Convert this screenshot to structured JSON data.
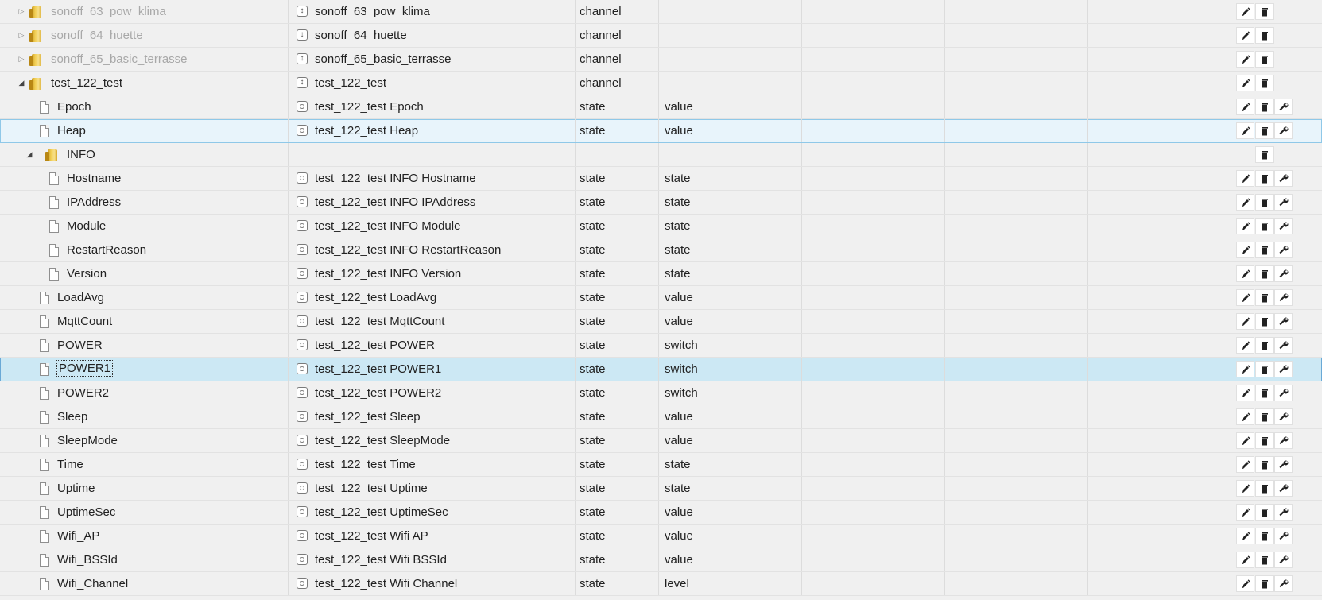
{
  "rows": [
    {
      "name": "sonoff_63_pow_klima",
      "kind": "folder",
      "level": 0,
      "toggle": "closed",
      "dim": true,
      "obj_icon": "channel-icon",
      "label": "sonoff_63_pow_klima",
      "type": "channel",
      "role": "",
      "buttons": [
        "edit",
        "delete"
      ]
    },
    {
      "name": "sonoff_64_huette",
      "kind": "folder",
      "level": 0,
      "toggle": "closed",
      "dim": true,
      "obj_icon": "channel-icon",
      "label": "sonoff_64_huette",
      "type": "channel",
      "role": "",
      "buttons": [
        "edit",
        "delete"
      ]
    },
    {
      "name": "sonoff_65_basic_terrasse",
      "kind": "folder",
      "level": 0,
      "toggle": "closed",
      "dim": true,
      "obj_icon": "channel-icon",
      "label": "sonoff_65_basic_terrasse",
      "type": "channel",
      "role": "",
      "buttons": [
        "edit",
        "delete"
      ]
    },
    {
      "name": "test_122_test",
      "kind": "folder",
      "level": 0,
      "toggle": "open",
      "dim": false,
      "obj_icon": "channel-icon",
      "label": "test_122_test",
      "type": "channel",
      "role": "",
      "buttons": [
        "edit",
        "delete"
      ]
    },
    {
      "name": "Epoch",
      "kind": "file",
      "level": 1,
      "obj_icon": "state-icon",
      "label": "test_122_test Epoch",
      "type": "state",
      "role": "value",
      "buttons": [
        "edit",
        "delete",
        "settings"
      ]
    },
    {
      "name": "Heap",
      "kind": "file",
      "level": 1,
      "obj_icon": "state-icon",
      "label": "test_122_test Heap",
      "type": "state",
      "role": "value",
      "buttons": [
        "edit",
        "delete",
        "settings"
      ],
      "state": "hover"
    },
    {
      "name": "INFO",
      "kind": "folder",
      "level": 1,
      "toggle": "open",
      "dim": false,
      "obj_icon": "",
      "label": "",
      "type": "",
      "role": "",
      "buttons": [
        "none",
        "delete"
      ]
    },
    {
      "name": "Hostname",
      "kind": "file",
      "level": 2,
      "obj_icon": "state-icon",
      "label": "test_122_test INFO Hostname",
      "type": "state",
      "role": "state",
      "buttons": [
        "edit",
        "delete",
        "settings"
      ]
    },
    {
      "name": "IPAddress",
      "kind": "file",
      "level": 2,
      "obj_icon": "state-icon",
      "label": "test_122_test INFO IPAddress",
      "type": "state",
      "role": "state",
      "buttons": [
        "edit",
        "delete",
        "settings"
      ]
    },
    {
      "name": "Module",
      "kind": "file",
      "level": 2,
      "obj_icon": "state-icon",
      "label": "test_122_test INFO Module",
      "type": "state",
      "role": "state",
      "buttons": [
        "edit",
        "delete",
        "settings"
      ]
    },
    {
      "name": "RestartReason",
      "kind": "file",
      "level": 2,
      "obj_icon": "state-icon",
      "label": "test_122_test INFO RestartReason",
      "type": "state",
      "role": "state",
      "buttons": [
        "edit",
        "delete",
        "settings"
      ]
    },
    {
      "name": "Version",
      "kind": "file",
      "level": 2,
      "obj_icon": "state-icon",
      "label": "test_122_test INFO Version",
      "type": "state",
      "role": "state",
      "buttons": [
        "edit",
        "delete",
        "settings"
      ]
    },
    {
      "name": "LoadAvg",
      "kind": "file",
      "level": 1,
      "obj_icon": "state-icon",
      "label": "test_122_test LoadAvg",
      "type": "state",
      "role": "value",
      "buttons": [
        "edit",
        "delete",
        "settings"
      ]
    },
    {
      "name": "MqttCount",
      "kind": "file",
      "level": 1,
      "obj_icon": "state-icon",
      "label": "test_122_test MqttCount",
      "type": "state",
      "role": "value",
      "buttons": [
        "edit",
        "delete",
        "settings"
      ]
    },
    {
      "name": "POWER",
      "kind": "file",
      "level": 1,
      "obj_icon": "state-icon",
      "label": "test_122_test POWER",
      "type": "state",
      "role": "switch",
      "buttons": [
        "edit",
        "delete",
        "settings"
      ]
    },
    {
      "name": "POWER1",
      "kind": "file",
      "level": 1,
      "obj_icon": "state-icon",
      "label": "test_122_test POWER1",
      "type": "state",
      "role": "switch",
      "buttons": [
        "edit",
        "delete",
        "settings"
      ],
      "state": "selected"
    },
    {
      "name": "POWER2",
      "kind": "file",
      "level": 1,
      "obj_icon": "state-icon",
      "label": "test_122_test POWER2",
      "type": "state",
      "role": "switch",
      "buttons": [
        "edit",
        "delete",
        "settings"
      ]
    },
    {
      "name": "Sleep",
      "kind": "file",
      "level": 1,
      "obj_icon": "state-icon",
      "label": "test_122_test Sleep",
      "type": "state",
      "role": "value",
      "buttons": [
        "edit",
        "delete",
        "settings"
      ]
    },
    {
      "name": "SleepMode",
      "kind": "file",
      "level": 1,
      "obj_icon": "state-icon",
      "label": "test_122_test SleepMode",
      "type": "state",
      "role": "value",
      "buttons": [
        "edit",
        "delete",
        "settings"
      ]
    },
    {
      "name": "Time",
      "kind": "file",
      "level": 1,
      "obj_icon": "state-icon",
      "label": "test_122_test Time",
      "type": "state",
      "role": "state",
      "buttons": [
        "edit",
        "delete",
        "settings"
      ]
    },
    {
      "name": "Uptime",
      "kind": "file",
      "level": 1,
      "obj_icon": "state-icon",
      "label": "test_122_test Uptime",
      "type": "state",
      "role": "state",
      "buttons": [
        "edit",
        "delete",
        "settings"
      ]
    },
    {
      "name": "UptimeSec",
      "kind": "file",
      "level": 1,
      "obj_icon": "state-icon",
      "label": "test_122_test UptimeSec",
      "type": "state",
      "role": "value",
      "buttons": [
        "edit",
        "delete",
        "settings"
      ]
    },
    {
      "name": "Wifi_AP",
      "kind": "file",
      "level": 1,
      "obj_icon": "state-icon",
      "label": "test_122_test Wifi AP",
      "type": "state",
      "role": "value",
      "buttons": [
        "edit",
        "delete",
        "settings"
      ]
    },
    {
      "name": "Wifi_BSSId",
      "kind": "file",
      "level": 1,
      "obj_icon": "state-icon",
      "label": "test_122_test Wifi BSSId",
      "type": "state",
      "role": "value",
      "buttons": [
        "edit",
        "delete",
        "settings"
      ]
    },
    {
      "name": "Wifi_Channel",
      "kind": "file",
      "level": 1,
      "obj_icon": "state-icon",
      "label": "test_122_test Wifi Channel",
      "type": "state",
      "role": "level",
      "buttons": [
        "edit",
        "delete",
        "settings"
      ]
    }
  ],
  "colors": {
    "background": "#f0f0f0",
    "hover_row": "#e8f4fb",
    "selected_row": "#cce8f4",
    "dim_text": "#a8a8a8",
    "folder": "#f2cf55"
  }
}
